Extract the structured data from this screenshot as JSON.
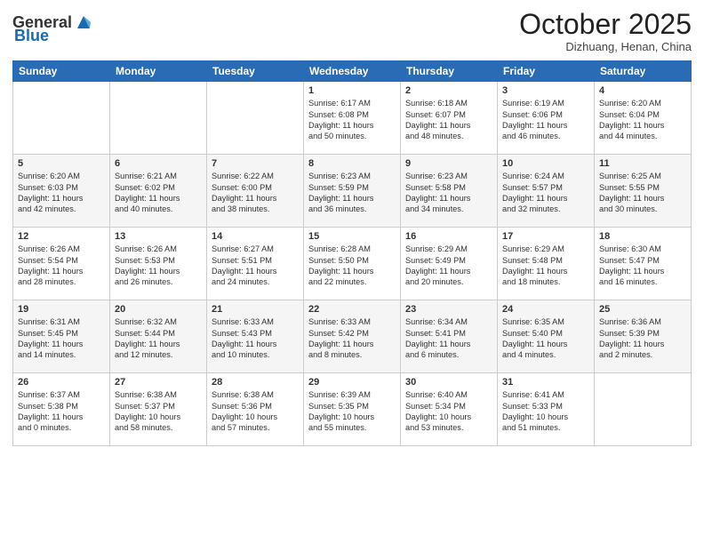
{
  "header": {
    "logo_general": "General",
    "logo_blue": "Blue",
    "month_title": "October 2025",
    "subtitle": "Dizhuang, Henan, China"
  },
  "days_of_week": [
    "Sunday",
    "Monday",
    "Tuesday",
    "Wednesday",
    "Thursday",
    "Friday",
    "Saturday"
  ],
  "weeks": [
    [
      {
        "day": "",
        "info": ""
      },
      {
        "day": "",
        "info": ""
      },
      {
        "day": "",
        "info": ""
      },
      {
        "day": "1",
        "info": "Sunrise: 6:17 AM\nSunset: 6:08 PM\nDaylight: 11 hours\nand 50 minutes."
      },
      {
        "day": "2",
        "info": "Sunrise: 6:18 AM\nSunset: 6:07 PM\nDaylight: 11 hours\nand 48 minutes."
      },
      {
        "day": "3",
        "info": "Sunrise: 6:19 AM\nSunset: 6:06 PM\nDaylight: 11 hours\nand 46 minutes."
      },
      {
        "day": "4",
        "info": "Sunrise: 6:20 AM\nSunset: 6:04 PM\nDaylight: 11 hours\nand 44 minutes."
      }
    ],
    [
      {
        "day": "5",
        "info": "Sunrise: 6:20 AM\nSunset: 6:03 PM\nDaylight: 11 hours\nand 42 minutes."
      },
      {
        "day": "6",
        "info": "Sunrise: 6:21 AM\nSunset: 6:02 PM\nDaylight: 11 hours\nand 40 minutes."
      },
      {
        "day": "7",
        "info": "Sunrise: 6:22 AM\nSunset: 6:00 PM\nDaylight: 11 hours\nand 38 minutes."
      },
      {
        "day": "8",
        "info": "Sunrise: 6:23 AM\nSunset: 5:59 PM\nDaylight: 11 hours\nand 36 minutes."
      },
      {
        "day": "9",
        "info": "Sunrise: 6:23 AM\nSunset: 5:58 PM\nDaylight: 11 hours\nand 34 minutes."
      },
      {
        "day": "10",
        "info": "Sunrise: 6:24 AM\nSunset: 5:57 PM\nDaylight: 11 hours\nand 32 minutes."
      },
      {
        "day": "11",
        "info": "Sunrise: 6:25 AM\nSunset: 5:55 PM\nDaylight: 11 hours\nand 30 minutes."
      }
    ],
    [
      {
        "day": "12",
        "info": "Sunrise: 6:26 AM\nSunset: 5:54 PM\nDaylight: 11 hours\nand 28 minutes."
      },
      {
        "day": "13",
        "info": "Sunrise: 6:26 AM\nSunset: 5:53 PM\nDaylight: 11 hours\nand 26 minutes."
      },
      {
        "day": "14",
        "info": "Sunrise: 6:27 AM\nSunset: 5:51 PM\nDaylight: 11 hours\nand 24 minutes."
      },
      {
        "day": "15",
        "info": "Sunrise: 6:28 AM\nSunset: 5:50 PM\nDaylight: 11 hours\nand 22 minutes."
      },
      {
        "day": "16",
        "info": "Sunrise: 6:29 AM\nSunset: 5:49 PM\nDaylight: 11 hours\nand 20 minutes."
      },
      {
        "day": "17",
        "info": "Sunrise: 6:29 AM\nSunset: 5:48 PM\nDaylight: 11 hours\nand 18 minutes."
      },
      {
        "day": "18",
        "info": "Sunrise: 6:30 AM\nSunset: 5:47 PM\nDaylight: 11 hours\nand 16 minutes."
      }
    ],
    [
      {
        "day": "19",
        "info": "Sunrise: 6:31 AM\nSunset: 5:45 PM\nDaylight: 11 hours\nand 14 minutes."
      },
      {
        "day": "20",
        "info": "Sunrise: 6:32 AM\nSunset: 5:44 PM\nDaylight: 11 hours\nand 12 minutes."
      },
      {
        "day": "21",
        "info": "Sunrise: 6:33 AM\nSunset: 5:43 PM\nDaylight: 11 hours\nand 10 minutes."
      },
      {
        "day": "22",
        "info": "Sunrise: 6:33 AM\nSunset: 5:42 PM\nDaylight: 11 hours\nand 8 minutes."
      },
      {
        "day": "23",
        "info": "Sunrise: 6:34 AM\nSunset: 5:41 PM\nDaylight: 11 hours\nand 6 minutes."
      },
      {
        "day": "24",
        "info": "Sunrise: 6:35 AM\nSunset: 5:40 PM\nDaylight: 11 hours\nand 4 minutes."
      },
      {
        "day": "25",
        "info": "Sunrise: 6:36 AM\nSunset: 5:39 PM\nDaylight: 11 hours\nand 2 minutes."
      }
    ],
    [
      {
        "day": "26",
        "info": "Sunrise: 6:37 AM\nSunset: 5:38 PM\nDaylight: 11 hours\nand 0 minutes."
      },
      {
        "day": "27",
        "info": "Sunrise: 6:38 AM\nSunset: 5:37 PM\nDaylight: 10 hours\nand 58 minutes."
      },
      {
        "day": "28",
        "info": "Sunrise: 6:38 AM\nSunset: 5:36 PM\nDaylight: 10 hours\nand 57 minutes."
      },
      {
        "day": "29",
        "info": "Sunrise: 6:39 AM\nSunset: 5:35 PM\nDaylight: 10 hours\nand 55 minutes."
      },
      {
        "day": "30",
        "info": "Sunrise: 6:40 AM\nSunset: 5:34 PM\nDaylight: 10 hours\nand 53 minutes."
      },
      {
        "day": "31",
        "info": "Sunrise: 6:41 AM\nSunset: 5:33 PM\nDaylight: 10 hours\nand 51 minutes."
      },
      {
        "day": "",
        "info": ""
      }
    ]
  ]
}
